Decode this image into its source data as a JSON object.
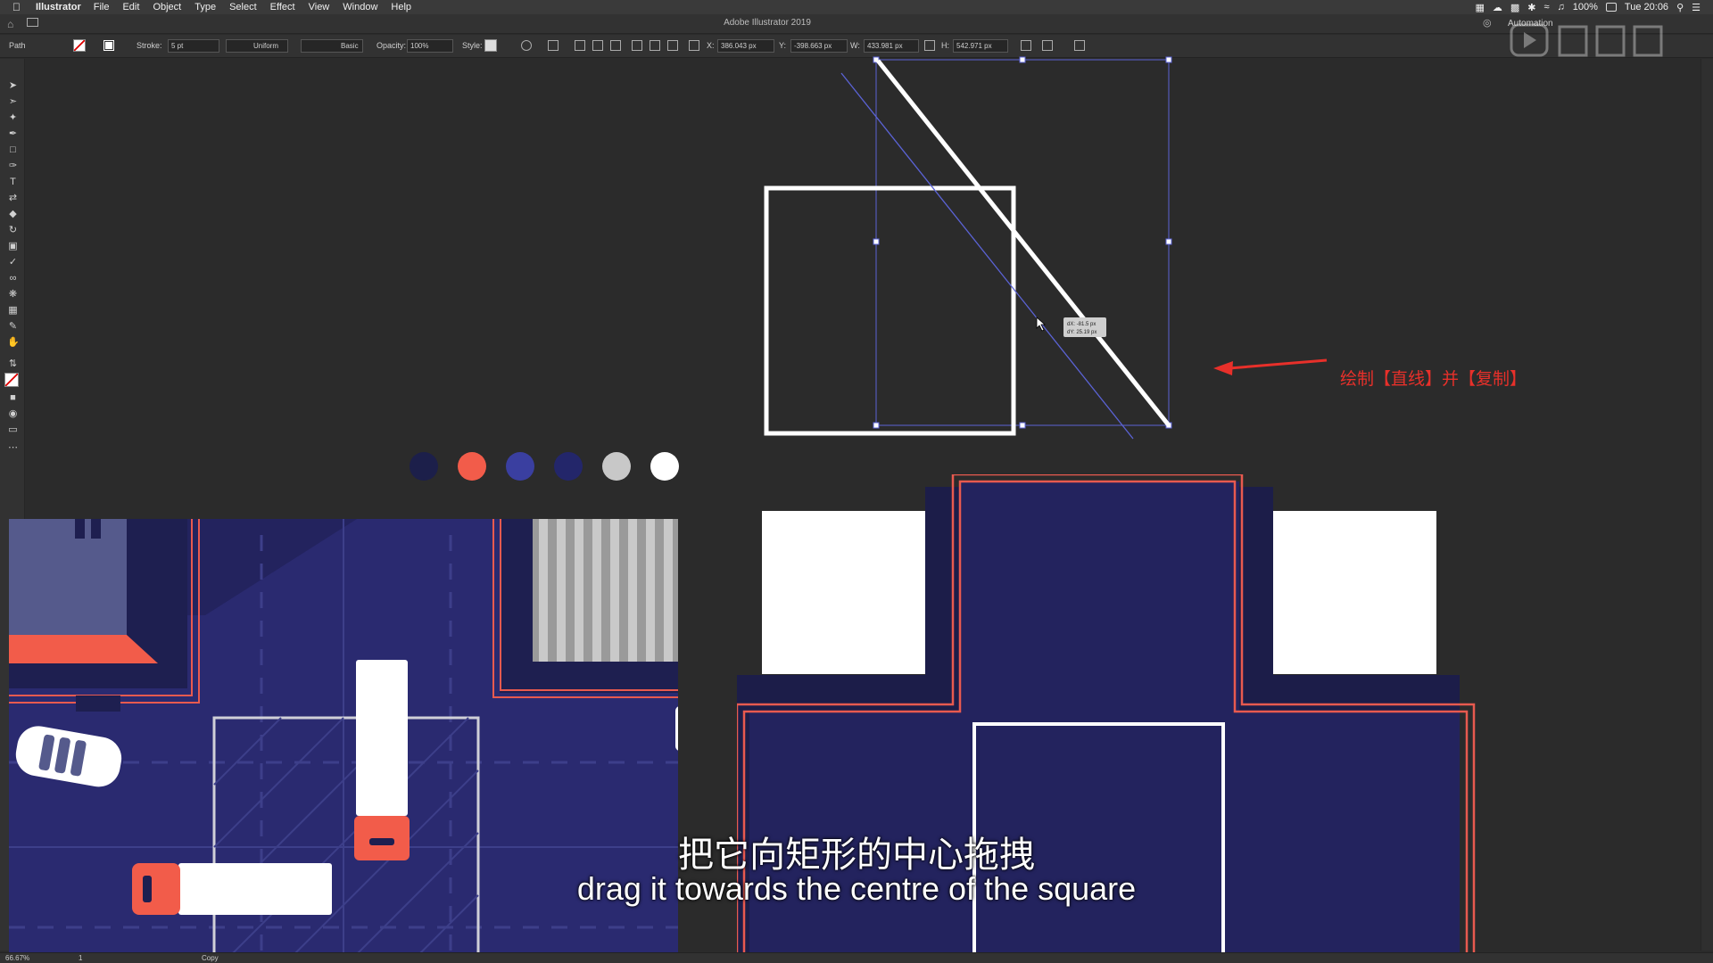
{
  "menubar": {
    "app_name": "Illustrator",
    "menus": [
      "File",
      "Edit",
      "Object",
      "Type",
      "Select",
      "Effect",
      "View",
      "Window",
      "Help"
    ],
    "battery": "100%",
    "clock": "Tue 20:06"
  },
  "titlebar": {
    "doc_title": "Adobe Illustrator 2019",
    "workspace": "Automation"
  },
  "controlbar": {
    "selection_type": "Path",
    "stroke_label": "Stroke:",
    "stroke_weight": "5 pt",
    "profile": "Uniform",
    "brush": "Basic",
    "opacity_label": "Opacity:",
    "opacity": "100%",
    "style_label": "Style:",
    "x_label": "X:",
    "x_value": "386.043 px",
    "y_label": "Y:",
    "y_value": "-398.663 px",
    "w_label": "W:",
    "w_value": "433.981 px",
    "h_label": "H:",
    "h_value": "542.971 px"
  },
  "drag_tooltip": {
    "dx": "dX: -81.5 px",
    "dy": "dY: 25.19 px"
  },
  "color_swatches": [
    "#1c1f4a",
    "#f25c4a",
    "#3a3fa0",
    "#23266a",
    "#c8c8c8",
    "#ffffff"
  ],
  "annotation": {
    "text": "绘制【直线】并【复制】",
    "color": "#e8302a"
  },
  "subtitles": {
    "chinese": "把它向矩形的中心拖拽",
    "english": "drag it towards the centre of the square"
  },
  "statusbar": {
    "zoom": "66.67%",
    "artboard": "1",
    "mode": "Copy"
  },
  "colors": {
    "navy": "#23235e",
    "coral": "#f25c4a",
    "canvas_bg": "#2b2b2b"
  }
}
